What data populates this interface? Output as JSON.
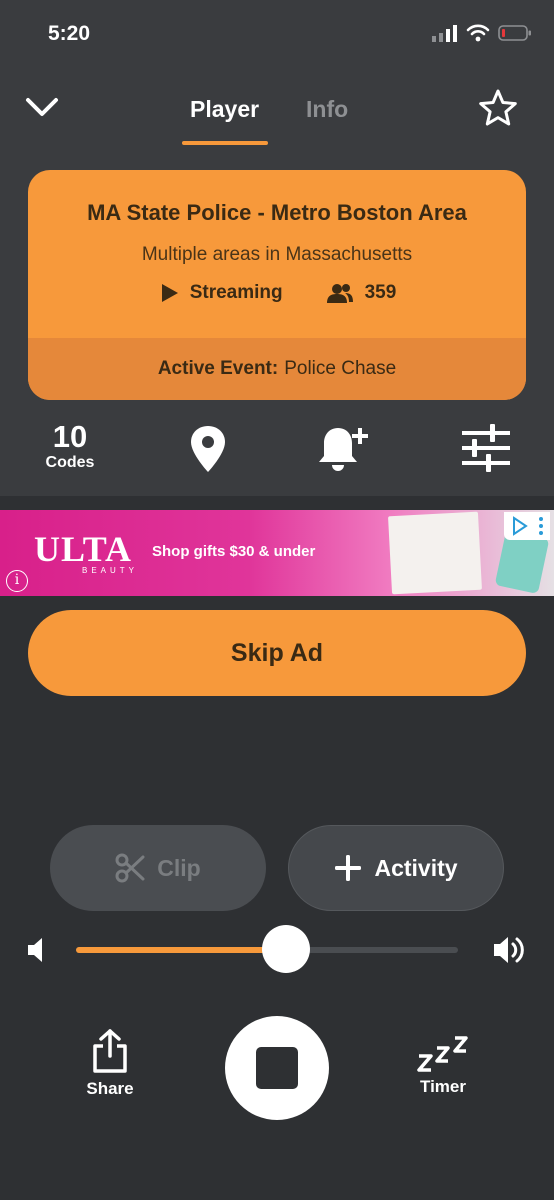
{
  "status_bar": {
    "time": "5:20"
  },
  "nav": {
    "tabs": [
      {
        "label": "Player",
        "active": true
      },
      {
        "label": "Info",
        "active": false
      }
    ]
  },
  "feed_card": {
    "title": "MA State Police - Metro Boston Area",
    "subtitle": "Multiple areas in Massachusetts",
    "status": "Streaming",
    "listeners": "359",
    "event_label": "Active Event:",
    "event_value": "Police Chase"
  },
  "toolbar": {
    "codes_count": "10",
    "codes_label": "Codes"
  },
  "ad": {
    "brand": "ULTA",
    "brand_sub": "BEAUTY",
    "text": "Shop gifts $30 & under"
  },
  "skip_ad_label": "Skip Ad",
  "actions": {
    "clip_label": "Clip",
    "activity_label": "Activity"
  },
  "volume": {
    "level": 0.55
  },
  "bottom": {
    "share_label": "Share",
    "timer_label": "Timer"
  },
  "colors": {
    "accent": "#f7993b",
    "background": "#2e3033",
    "panel": "#3a3c3f"
  }
}
